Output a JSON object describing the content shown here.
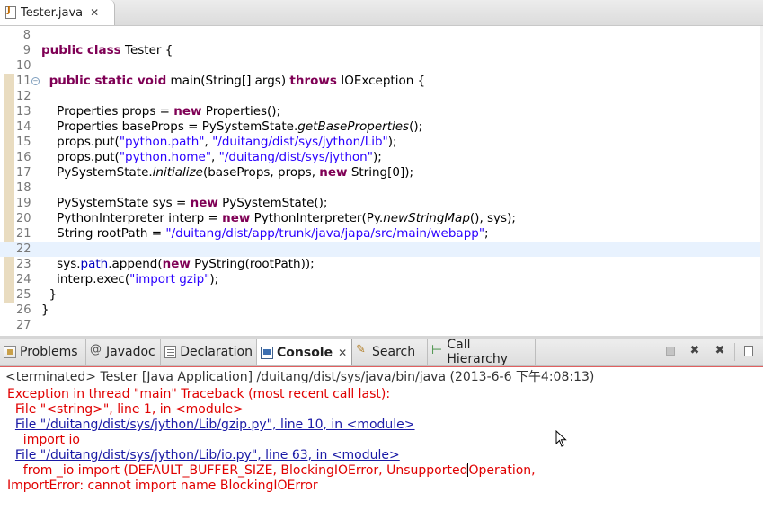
{
  "editor_tab": {
    "title": "Tester.java",
    "close": "✕"
  },
  "code_lines": [
    {
      "n": "8",
      "html": ""
    },
    {
      "n": "9",
      "html": "<span class=\"kw\">public class</span> Tester {"
    },
    {
      "n": "10",
      "html": ""
    },
    {
      "n": "11",
      "html": "  <span class=\"kw\">public static void</span> main(String[] args) <span class=\"kw\">throws</span> IOException {",
      "fold": true
    },
    {
      "n": "12",
      "html": ""
    },
    {
      "n": "13",
      "html": "    Properties props = <span class=\"kw\">new</span> Properties();"
    },
    {
      "n": "14",
      "html": "    Properties baseProps = PySystemState.<span class=\"it\">getBaseProperties</span>();"
    },
    {
      "n": "15",
      "html": "    props.put(<span class=\"str\">\"python.path\"</span>, <span class=\"str\">\"/duitang/dist/sys/jython/Lib\"</span>);"
    },
    {
      "n": "16",
      "html": "    props.put(<span class=\"str\">\"python.home\"</span>, <span class=\"str\">\"/duitang/dist/sys/jython\"</span>);"
    },
    {
      "n": "17",
      "html": "    PySystemState.<span class=\"it\">initialize</span>(baseProps, props, <span class=\"kw\">new</span> String[0]);"
    },
    {
      "n": "18",
      "html": ""
    },
    {
      "n": "19",
      "html": "    PySystemState sys = <span class=\"kw\">new</span> PySystemState();"
    },
    {
      "n": "20",
      "html": "    PythonInterpreter interp = <span class=\"kw\">new</span> PythonInterpreter(Py.<span class=\"it\">newStringMap</span>(), sys);"
    },
    {
      "n": "21",
      "html": "    String rootPath = <span class=\"str\">\"/duitang/dist/app/trunk/java/japa/src/main/webapp\"</span>;"
    },
    {
      "n": "22",
      "html": "",
      "current": true
    },
    {
      "n": "23",
      "html": "    sys.<span class=\"fld\">path</span>.append(<span class=\"kw\">new</span> PyString(rootPath));"
    },
    {
      "n": "24",
      "html": "    interp.exec(<span class=\"str\">\"import gzip\"</span>);"
    },
    {
      "n": "25",
      "html": "  }"
    },
    {
      "n": "26",
      "html": "}"
    },
    {
      "n": "27",
      "html": ""
    }
  ],
  "view_tabs": {
    "problems": "Problems",
    "javadoc": "Javadoc",
    "declaration": "Declaration",
    "console": "Console",
    "search": "Search",
    "call_hierarchy": "Call Hierarchy",
    "close": "✕"
  },
  "toolbar": {
    "remove": "✖",
    "remove_all": "✖"
  },
  "console": {
    "header": "<terminated> Tester [Java Application] /duitang/dist/sys/java/bin/java (2013-6-6 下午4:08:13)",
    "lines": [
      {
        "text": "Exception in thread \"main\" Traceback (most recent call last):"
      },
      {
        "text": "  File \"<string>\", line 1, in <module>"
      },
      {
        "text": "  ",
        "link": "File \"/duitang/dist/sys/jython/Lib/gzip.py\", line 10, in <module>"
      },
      {
        "text": "    import io"
      },
      {
        "text": "  ",
        "link": "File \"/duitang/dist/sys/jython/Lib/io.py\", line 63, in <module>"
      },
      {
        "text": "    from _io import (DEFAULT_BUFFER_SIZE, BlockingIOError, Unsupported",
        "caret": true,
        "after": "Operation,"
      },
      {
        "text": "ImportError: cannot import name BlockingIOError"
      }
    ]
  }
}
